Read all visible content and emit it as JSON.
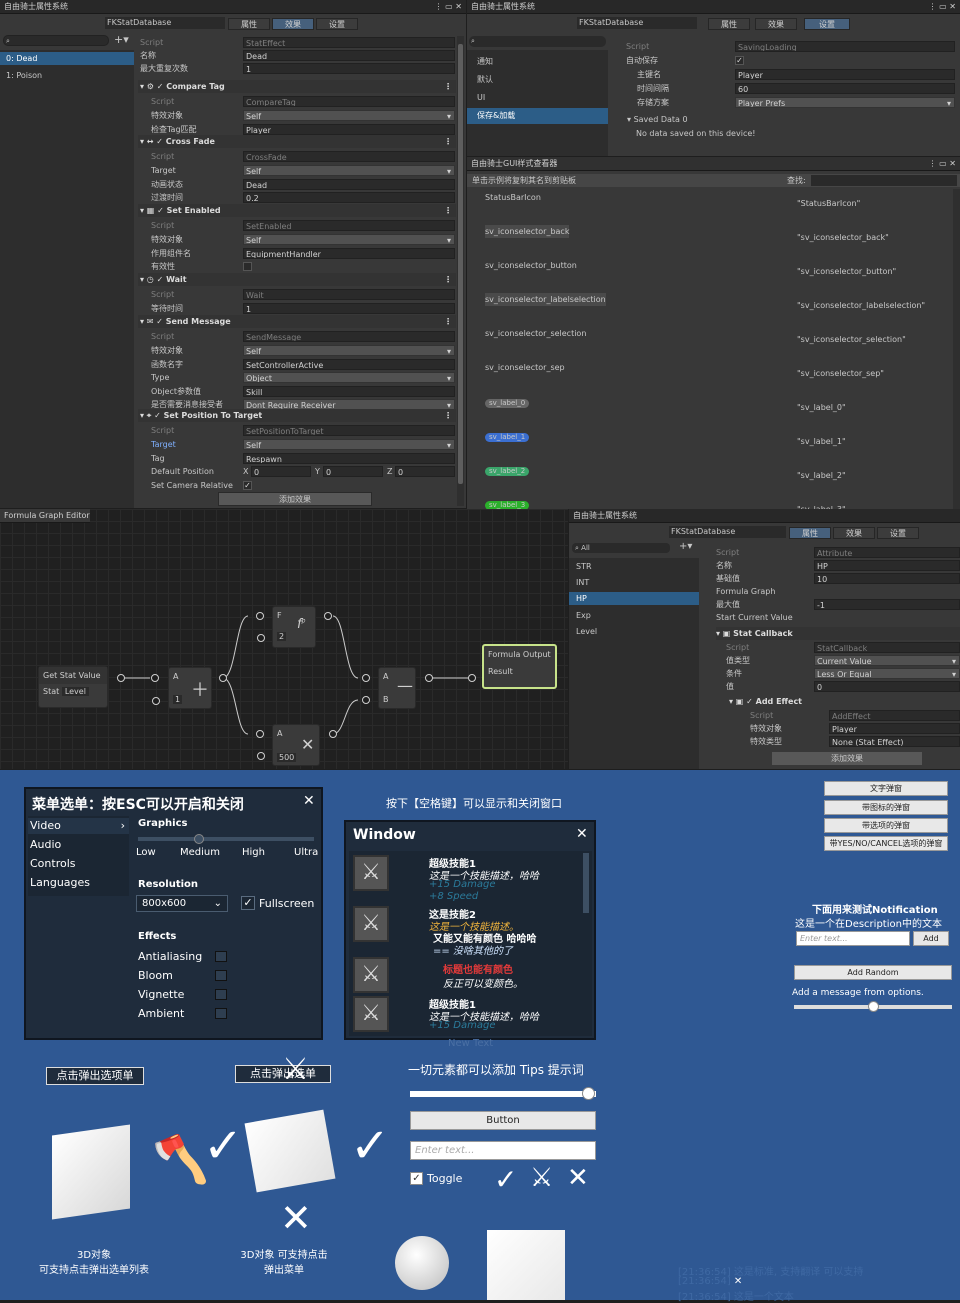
{
  "inspector1": {
    "title": "自由骑士属性系统",
    "db": "FKStatDatabase",
    "tabs": [
      "属性",
      "效果",
      "设置"
    ],
    "list": [
      "0: Dead",
      "1: Poison"
    ],
    "script_label": "Script",
    "script_value": "StatEffect",
    "name_label": "名称",
    "name_value": "Dead",
    "max_label": "最大重复次数",
    "max_value": "1",
    "blocks": [
      {
        "title": "Compare Tag",
        "script": "CompareTag",
        "rows": [
          [
            "特效对象",
            "Self"
          ],
          [
            "检查Tag匹配",
            "Player"
          ]
        ]
      },
      {
        "title": "Cross Fade",
        "script": "CrossFade",
        "rows": [
          [
            "Target",
            "Self"
          ],
          [
            "动画状态",
            "Dead"
          ],
          [
            "过渡时间",
            "0.2"
          ]
        ]
      },
      {
        "title": "Set Enabled",
        "script": "SetEnabled",
        "rows": [
          [
            "特效对象",
            "Self"
          ],
          [
            "作用组件名",
            "EquipmentHandler"
          ],
          [
            "有效性",
            ""
          ]
        ]
      },
      {
        "title": "Wait",
        "script": "Wait",
        "rows": [
          [
            "等待时间",
            "1"
          ]
        ]
      },
      {
        "title": "Send Message",
        "script": "SendMessage",
        "rows": [
          [
            "特效对象",
            "Self"
          ],
          [
            "函数名字",
            "SetControllerActive"
          ],
          [
            "Type",
            "Object"
          ],
          [
            "Object参数值",
            "Skill"
          ],
          [
            "是否需要消息接受者",
            "Dont Require Receiver"
          ]
        ]
      },
      {
        "title": "Set Position To Target",
        "script": "SetPositionToTarget",
        "rows": [
          [
            "Target",
            "Self"
          ],
          [
            "Tag",
            "Respawn"
          ],
          [
            "Default Position",
            ""
          ],
          [
            "Set Camera Relative",
            ""
          ]
        ]
      }
    ],
    "vec": [
      "X",
      "0",
      "Y",
      "0",
      "Z",
      "0"
    ],
    "add_btn": "添加效果"
  },
  "inspector2": {
    "title": "自由骑士属性系统",
    "db": "FKStatDatabase",
    "tabs": [
      "属性",
      "效果",
      "设置"
    ],
    "list": [
      "通知",
      "默认",
      "UI",
      "保存&加载"
    ],
    "script_label": "Script",
    "script_value": "SavingLoading",
    "rows": [
      [
        "自动保存",
        ""
      ],
      [
        "主键名",
        "Player"
      ],
      [
        "时间间隔",
        "60"
      ],
      [
        "存储方案",
        "Player Prefs"
      ]
    ],
    "saved": "Saved Data 0",
    "nodata": "No data saved on this device!"
  },
  "styleviewer": {
    "title": "自由骑士GUI样式查看器",
    "hint": "单击示例将复制其名到剪贴板",
    "search": "查找:",
    "items": [
      [
        "StatusBarIcon",
        "\"StatusBarIcon\""
      ],
      [
        "sv_iconselector_back",
        "\"sv_iconselector_back\""
      ],
      [
        "sv_iconselector_button",
        "\"sv_iconselector_button\""
      ],
      [
        "sv_iconselector_labelselection",
        "\"sv_iconselector_labelselection\""
      ],
      [
        "sv_iconselector_selection",
        "\"sv_iconselector_selection\""
      ],
      [
        "sv_iconselector_sep",
        "\"sv_iconselector_sep\""
      ],
      [
        "sv_label_0",
        "\"sv_label_0\""
      ],
      [
        "sv_label_1",
        "\"sv_label_1\""
      ],
      [
        "sv_label_2",
        "\"sv_label_2\""
      ],
      [
        "sv_label_3",
        "\"sv_label_3\""
      ]
    ]
  },
  "graph": {
    "title": "Formula Graph Editor",
    "getstat": "Get Stat Value",
    "stat_label": "Stat",
    "stat_value": "Level",
    "a": "A",
    "b": "B",
    "one": "1",
    "two": "2",
    "five": "500",
    "f": "F",
    "output": "Formula Output",
    "result": "Result"
  },
  "inspector3": {
    "title": "自由骑士属性系统",
    "db": "FKStatDatabase",
    "tabs": [
      "属性",
      "效果",
      "设置"
    ],
    "search": "All",
    "list": [
      "STR",
      "INT",
      "HP",
      "Exp",
      "Level"
    ],
    "script_label": "Script",
    "script_value": "Attribute",
    "rows": [
      [
        "名称",
        "HP"
      ],
      [
        "基础值",
        "10"
      ]
    ],
    "formula": "Formula Graph",
    "max_label": "最大值",
    "max_value": "-1",
    "start_label": "Start Current Value",
    "callback": "Stat Callback",
    "cb_script": "StatCallback",
    "cb_rows": [
      [
        "值类型",
        "Current Value"
      ],
      [
        "条件",
        "Less Or Equal"
      ],
      [
        "值",
        "0"
      ]
    ],
    "effect": "Add Effect",
    "eff_script": "AddEffect",
    "eff_rows": [
      [
        "特效对象",
        "Player"
      ],
      [
        "特效类型",
        "None (Stat Effect)"
      ]
    ],
    "add_btn": "添加效果"
  },
  "game": {
    "menu_title": "菜单选单：按ESC可以开启和关闭",
    "menu_items": [
      "Video",
      "Audio",
      "Controls",
      "Languages"
    ],
    "graphics": "Graphics",
    "quality": [
      "Low",
      "Medium",
      "High",
      "Ultra"
    ],
    "resolution": "Resolution",
    "res_value": "800x600",
    "fullscreen": "Fullscreen",
    "effects": "Effects",
    "effect_items": [
      "Antialiasing",
      "Bloom",
      "Vignette",
      "Ambient"
    ],
    "space_hint": "按下【空格键】可以显示和关闭窗口",
    "window_title": "Window",
    "skills": [
      {
        "name": "超级技能1",
        "desc": "这是一个技能描述，哈哈",
        "extra": [
          "+15    Damage",
          "+8    Speed"
        ]
      },
      {
        "name": "这是技能2",
        "desc": "这是一个技能描述。",
        "extra": [
          "又能又能有颜色 哈哈哈",
          "== 没啥其他的了"
        ]
      },
      {
        "name": "",
        "desc": "标题也能有颜色",
        "extra": [
          "反正可以变颜色。"
        ]
      },
      {
        "name": "超级技能1",
        "desc": "这是一个技能描述，哈哈",
        "extra": [
          "+15    Damage"
        ]
      }
    ],
    "new_text": "New Text",
    "right_btns": [
      "文字弹窗",
      "带图标的弹窗",
      "带选项的弹窗",
      "带YES/NO/CANCEL选项的弹窗"
    ],
    "notif_title": "下面用来测试Notification",
    "notif_desc": "这是一个在Description中的文本",
    "enter_text": "Enter text...",
    "add": "Add",
    "add_random": "Add Random",
    "add_msg": "Add a message from options.",
    "popup1": "点击弹出选项单",
    "popup2": "点击弹出选单",
    "tips": "一切元素都可以添加 Tips 提示词",
    "button": "Button",
    "toggle": "Toggle",
    "obj1": "3D对象\n可支持点击弹出选单列表",
    "obj2": "3D对象 可支持点击\n弹出菜单",
    "log": [
      "[21:36:54] 这是标准, 支持翻译 可以支持",
      "[21:36:54]",
      "[21:36:54] 这是一个文本"
    ]
  }
}
